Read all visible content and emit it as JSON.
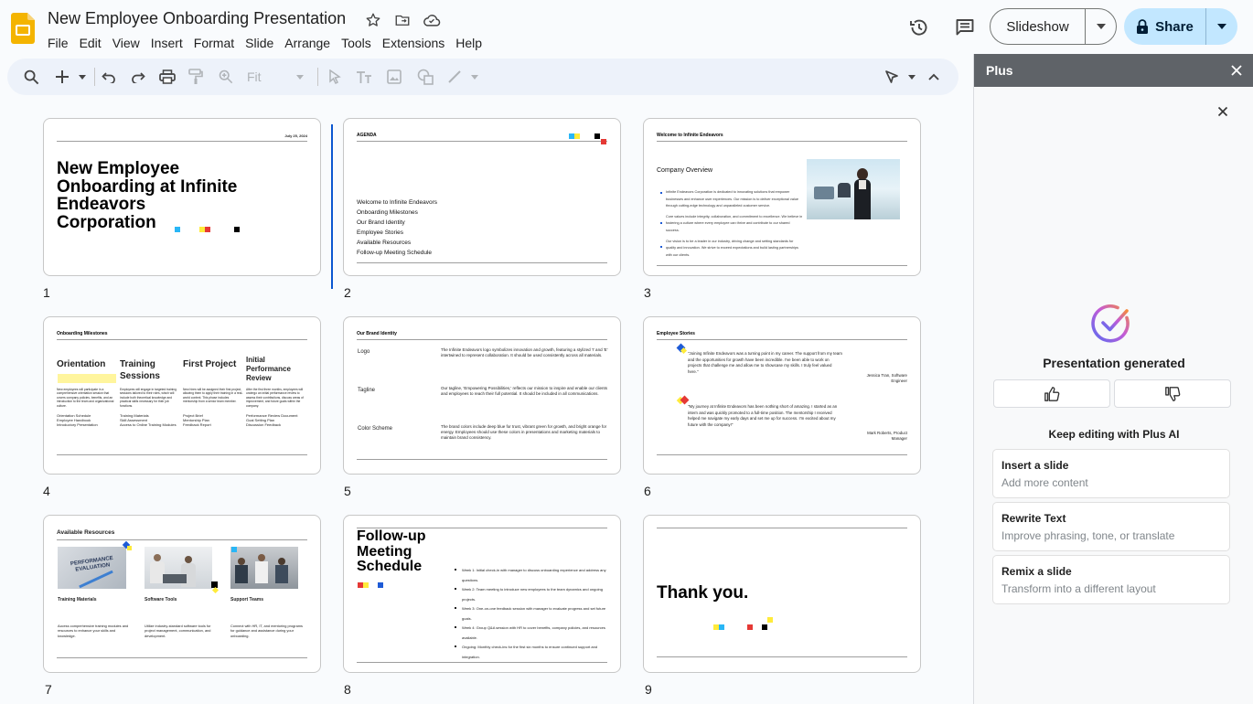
{
  "header": {
    "doc_title": "New Employee Onboarding Presentation",
    "menu": [
      "File",
      "Edit",
      "View",
      "Insert",
      "Format",
      "Slide",
      "Arrange",
      "Tools",
      "Extensions",
      "Help"
    ],
    "slideshow_label": "Slideshow",
    "share_label": "Share"
  },
  "toolbar": {
    "zoom_value": "Fit"
  },
  "slides": [
    {
      "number": "1",
      "date": "July 25, 2024",
      "title": "New Employee Onboarding at Infinite Endeavors Corporation"
    },
    {
      "number": "2",
      "heading": "AGENDA",
      "items": [
        "Welcome to Infinite Endeavors",
        "Onboarding Milestones",
        "Our Brand Identity",
        "Employee Stories",
        "Available Resources",
        "Follow-up Meeting Schedule"
      ]
    },
    {
      "number": "3",
      "heading": "Welcome to Infinite Endeavors",
      "subtitle": "Company Overview",
      "bullets": [
        "Infinite Endeavors Corporation is dedicated to innovating solutions that empower businesses and enhance user experiences. Our mission is to deliver exceptional value through cutting-edge technology and unparalleled customer service.",
        "Core values include integrity, collaboration, and commitment to excellence. We believe in fostering a culture where every employee can thrive and contribute to our shared success.",
        "Our vision is to be a leader in our industry, driving change and setting standards for quality and innovation. We strive to exceed expectations and build lasting partnerships with our clients."
      ]
    },
    {
      "number": "4",
      "heading": "Onboarding Milestones",
      "columns": [
        {
          "title": "Orientation",
          "desc": "New employees will participate in a comprehensive orientation session that covers company policies, benefits, and an introduction to the team and organizational culture.",
          "items": "Orientation Schedule\nEmployee Handbook\nIntroductory Presentation"
        },
        {
          "title": "Training Sessions",
          "desc": "Employees will engage in targeted training sessions tailored to their roles, which will include both theoretical knowledge and practical skills necessary for their job functions.",
          "items": "Training Materials\nSkill Assessment\nAccess to Online Training Modules"
        },
        {
          "title": "First Project",
          "desc": "New hires will be assigned their first project, allowing them to apply their training in a real-world context. This phase includes mentorship from a senior team member.",
          "items": "Project Brief\nMentorship Plan\nFeedback Report"
        },
        {
          "title": "Initial Performance Review",
          "desc": "After the first three months, employees will undergo an initial performance review to assess their contributions, discuss areas of improvement, and future goals within the company.",
          "items": "Performance Review Document\nGoal Setting Plan\nDiscussion Feedback"
        }
      ]
    },
    {
      "number": "5",
      "heading": "Our Brand Identity",
      "rows": [
        {
          "label": "Logo",
          "text": "The Infinite Endeavors logo symbolizes innovation and growth, featuring a stylized 'I' and 'E' intertwined to represent collaboration. It should be used consistently across all materials."
        },
        {
          "label": "Tagline",
          "text": "Our tagline, 'Empowering Possibilities,' reflects our mission to inspire and enable our clients and employees to reach their full potential. It should be included in all communications."
        },
        {
          "label": "Color Scheme",
          "text": "The brand colors include deep blue for trust, vibrant green for growth, and bright orange for energy. Employees should use these colors in presentations and marketing materials to maintain brand consistency."
        }
      ]
    },
    {
      "number": "6",
      "heading": "Employee Stories",
      "quotes": [
        {
          "text": "\"Joining Infinite Endeavors was a turning point in my career. The support from my team and the opportunities for growth have been incredible. I've been able to work on projects that challenge me and allow me to showcase my skills. I truly feel valued here.\"",
          "author": "Jessica Tran, Software Engineer"
        },
        {
          "text": "\"My journey at Infinite Endeavors has been nothing short of amazing. I started as an intern and was quickly promoted to a full-time position. The mentorship I received helped me navigate my early days and set me up for success. I'm excited about my future with the company!\"",
          "author": "Mark Roberts, Product Manager"
        }
      ]
    },
    {
      "number": "7",
      "heading": "Available Resources",
      "image_text": "PERFORMANCE EVALUATION",
      "cards": [
        {
          "title": "Training Materials",
          "text": "Access comprehensive training modules and resources to enhance your skills and knowledge."
        },
        {
          "title": "Software Tools",
          "text": "Utilize industry-standard software tools for project management, communication, and development."
        },
        {
          "title": "Support Teams",
          "text": "Connect with HR, IT, and mentoring programs for guidance and assistance during your onboarding."
        }
      ]
    },
    {
      "number": "8",
      "title": "Follow-up Meeting Schedule",
      "bullets": [
        "Week 1: Initial check-in with manager to discuss onboarding experience and address any questions.",
        "Week 2: Team meeting to introduce new employees to the team dynamics and ongoing projects.",
        "Week 3: One-on-one feedback session with manager to evaluate progress and set future goals.",
        "Week 4: Group Q&A session with HR to cover benefits, company policies, and resources available.",
        "Ongoing: Monthly check-ins for the first six months to ensure continued support and integration."
      ]
    },
    {
      "number": "9",
      "title": "Thank you."
    }
  ],
  "panel": {
    "title": "Plus",
    "generated_text": "Presentation generated",
    "keep_editing": "Keep editing with Plus AI",
    "options": [
      {
        "title": "Insert a slide",
        "subtitle": "Add more content"
      },
      {
        "title": "Rewrite Text",
        "subtitle": "Improve phrasing, tone, or translate"
      },
      {
        "title": "Remix a slide",
        "subtitle": "Transform into a different layout"
      }
    ]
  },
  "colors": {
    "accent_blue": "#0b57d0",
    "share_bg": "#c2e7ff",
    "brand_cyan": "#29b6f6",
    "brand_yellow": "#ffeb3b",
    "brand_red": "#e53935",
    "brand_blue": "#1e5bd6",
    "panel_header": "#5f6368"
  },
  "icons": [
    "slides-logo",
    "star-icon",
    "move-to-folder-icon",
    "cloud-status-icon",
    "history-icon",
    "comment-icon",
    "lock-icon",
    "chevron-down-icon",
    "search-icon",
    "plus-icon",
    "undo-icon",
    "redo-icon",
    "print-icon",
    "paint-format-icon",
    "zoom-icon",
    "select-icon",
    "text-box-icon",
    "image-icon",
    "shape-icon",
    "line-icon",
    "pen-icon",
    "collapse-icon",
    "close-icon",
    "check-circle-icon",
    "thumbs-up-icon",
    "thumbs-down-icon"
  ]
}
